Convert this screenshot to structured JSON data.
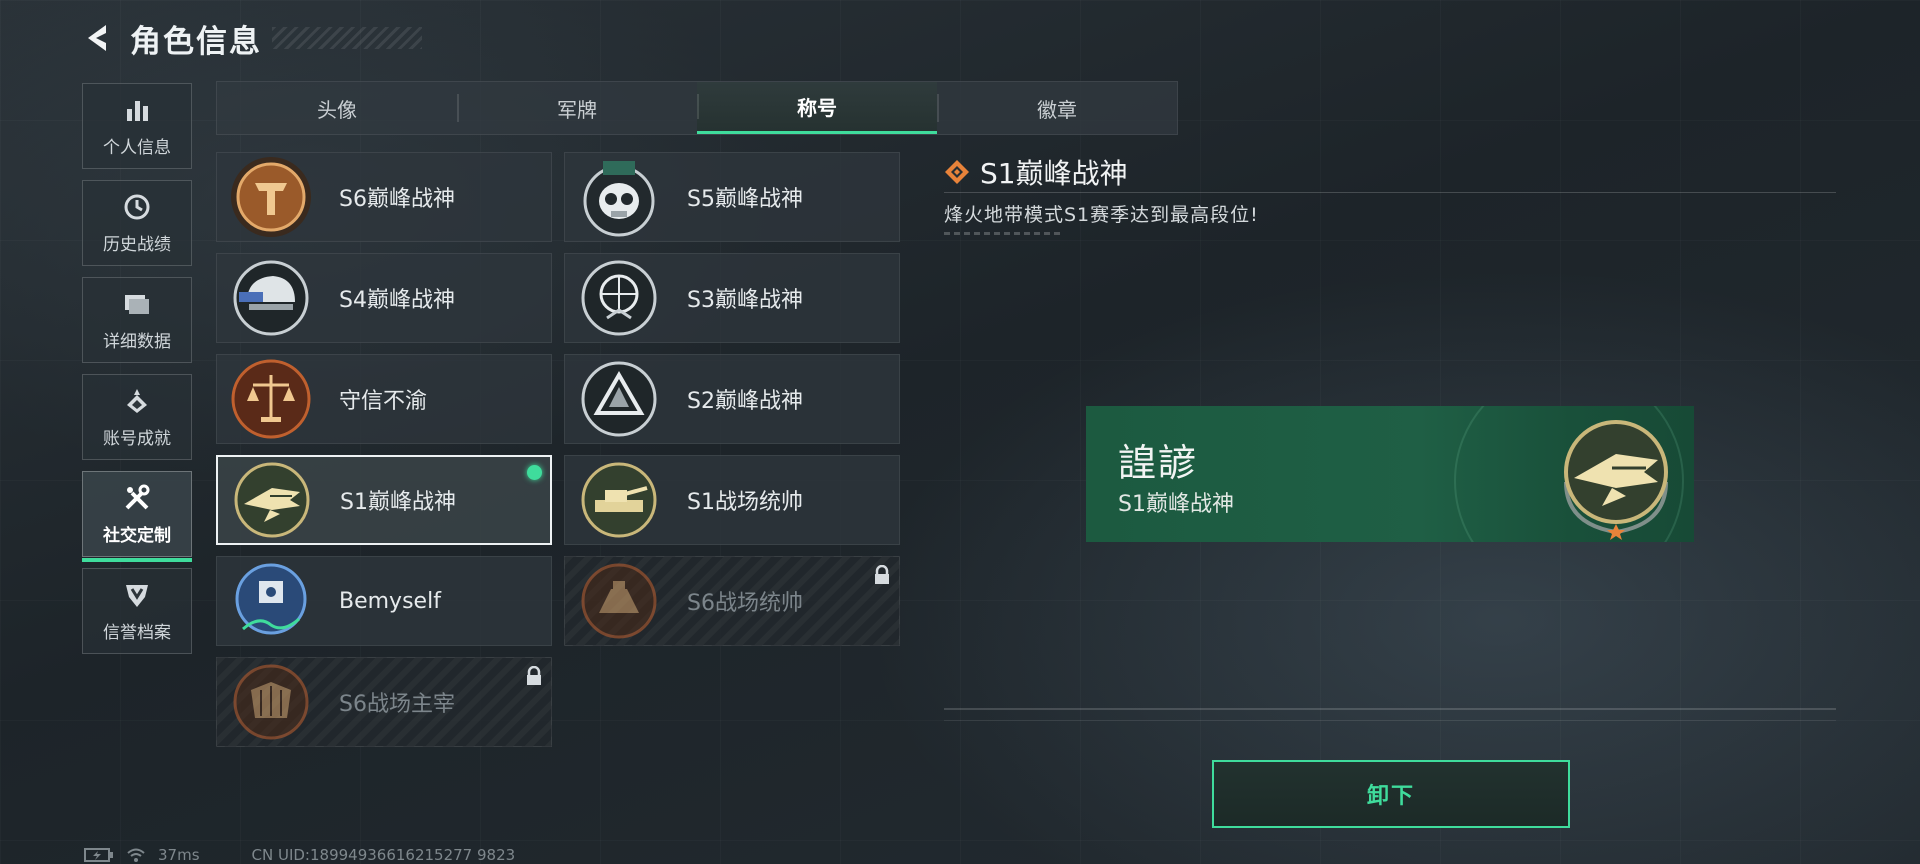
{
  "header": {
    "title": "角色信息"
  },
  "side_nav": [
    {
      "label": "个人信息",
      "icon": "bar-chart-icon",
      "active": false
    },
    {
      "label": "历史战绩",
      "icon": "history-clock-icon",
      "active": false
    },
    {
      "label": "详细数据",
      "icon": "folder-icon",
      "active": false
    },
    {
      "label": "账号成就",
      "icon": "achievement-icon",
      "active": false
    },
    {
      "label": "社交定制",
      "icon": "tools-icon",
      "active": true
    },
    {
      "label": "信誉档案",
      "icon": "credit-shield-icon",
      "active": false
    }
  ],
  "tabs": [
    {
      "label": "头像",
      "active": false
    },
    {
      "label": "军牌",
      "active": false
    },
    {
      "label": "称号",
      "active": true
    },
    {
      "label": "徽章",
      "active": false
    }
  ],
  "titles": [
    {
      "label": "S6巅峰战神",
      "badge": "bronze-t-emblem",
      "state": "normal"
    },
    {
      "label": "S5巅峰战神",
      "badge": "skull-emblem",
      "state": "normal"
    },
    {
      "label": "S4巅峰战神",
      "badge": "helmet-emblem",
      "state": "normal"
    },
    {
      "label": "S3巅峰战神",
      "badge": "globe-emblem",
      "state": "normal"
    },
    {
      "label": "守信不渝",
      "badge": "scales-emblem",
      "state": "normal"
    },
    {
      "label": "S2巅峰战神",
      "badge": "triangle-emblem",
      "state": "normal"
    },
    {
      "label": "S1巅峰战神",
      "badge": "crocodile-emblem",
      "state": "equipped"
    },
    {
      "label": "S1战场统帅",
      "badge": "tank-emblem",
      "state": "normal"
    },
    {
      "label": "Bemyself",
      "badge": "robot-emblem",
      "state": "normal"
    },
    {
      "label": "S6战场统帅",
      "badge": "mech-emblem",
      "state": "locked"
    },
    {
      "label": "S6战场主宰",
      "badge": "fist-emblem",
      "state": "locked"
    }
  ],
  "detail": {
    "title": "S1巅峰战神",
    "description": "烽火地带模式S1赛季达到最高段位!",
    "preview_name": "諻諺",
    "preview_title": "S1巅峰战神",
    "button_label": "卸下"
  },
  "status": {
    "ping": "37ms",
    "uid": "CN UID:18994936616215277 9823"
  },
  "colors": {
    "accent": "#3fdc9c",
    "preview_bg": "#1f5f45",
    "title_diamond": "#e8833a"
  }
}
